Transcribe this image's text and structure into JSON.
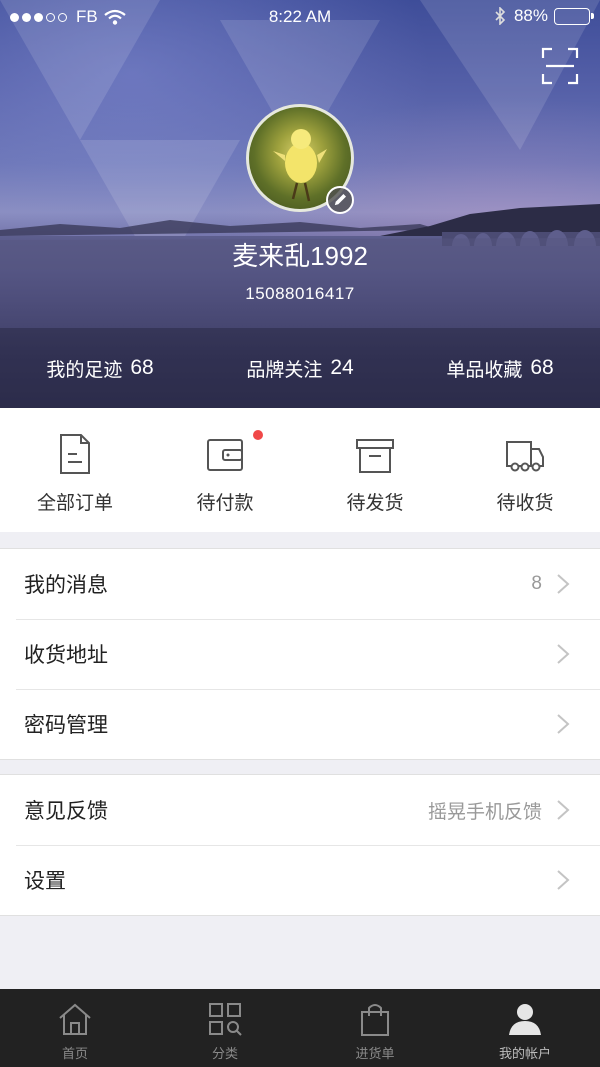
{
  "status_bar": {
    "carrier": "FB",
    "time": "8:22 AM",
    "battery": "88%",
    "battery_level": 0.88
  },
  "profile": {
    "username": "麦来乱1992",
    "phone": "15088016417"
  },
  "stats": [
    {
      "label": "我的足迹",
      "value": "68"
    },
    {
      "label": "品牌关注",
      "value": "24"
    },
    {
      "label": "单品收藏",
      "value": "68"
    }
  ],
  "orders": [
    {
      "label": "全部订单",
      "icon": "document-icon"
    },
    {
      "label": "待付款",
      "icon": "wallet-icon",
      "badge": true
    },
    {
      "label": "待发货",
      "icon": "box-icon"
    },
    {
      "label": "待收货",
      "icon": "truck-icon"
    }
  ],
  "menu_group_1": [
    {
      "title": "我的消息",
      "value": "8"
    },
    {
      "title": "收货地址",
      "value": ""
    },
    {
      "title": "密码管理",
      "value": ""
    }
  ],
  "menu_group_2": [
    {
      "title": "意见反馈",
      "value": "摇晃手机反馈"
    },
    {
      "title": "设置",
      "value": ""
    }
  ],
  "tabs": [
    {
      "label": "首页",
      "icon": "home-icon"
    },
    {
      "label": "分类",
      "icon": "category-icon"
    },
    {
      "label": "进货单",
      "icon": "shopping-bag-icon"
    },
    {
      "label": "我的帐户",
      "icon": "user-icon",
      "active": true
    }
  ],
  "colors": {
    "badge_red": "#f04848",
    "tabbar_bg": "#222222",
    "page_bg": "#efeff4"
  }
}
